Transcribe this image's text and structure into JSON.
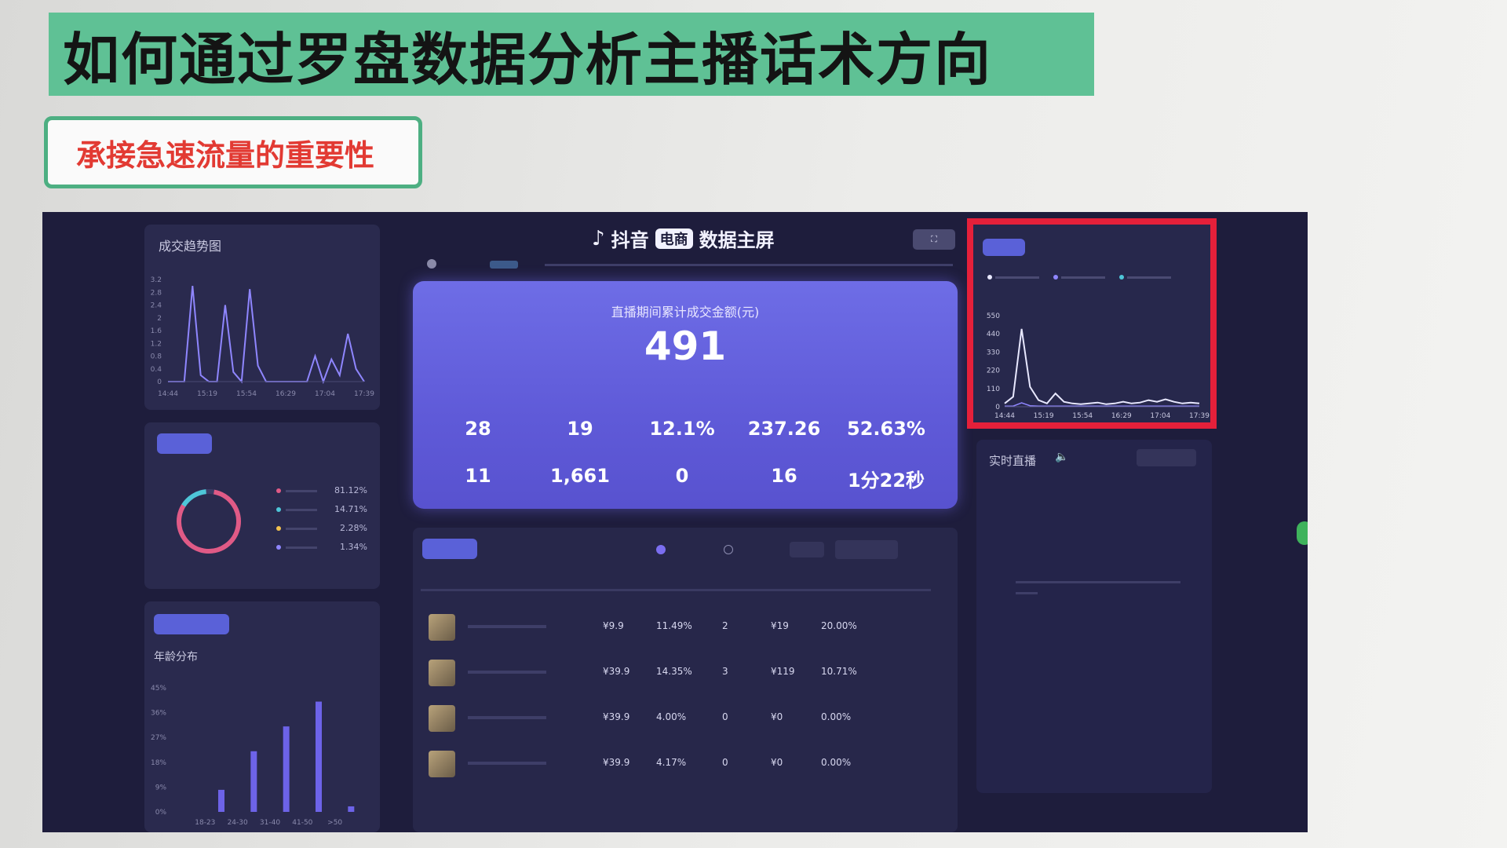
{
  "slide": {
    "title": "如何通过罗盘数据分析主播话术方向",
    "subtitle": "承接急速流量的重要性"
  },
  "left": {
    "trend_title": "成交趋势图",
    "trend_x": [
      "14:44",
      "15:19",
      "15:54",
      "16:29",
      "17:04",
      "17:39"
    ],
    "trend_y": [
      "3.2",
      "2.8",
      "2.4",
      "2",
      "1.6",
      "1.2",
      "0.8",
      "0.4",
      "0"
    ],
    "trend_values": [
      0,
      0,
      0,
      3.0,
      0.2,
      0,
      0,
      2.4,
      0.3,
      0,
      2.9,
      0.5,
      0,
      0,
      0,
      0,
      0,
      0,
      0.8,
      0,
      0.7,
      0.2,
      1.5,
      0.4,
      0
    ],
    "source_values": [
      "81.12%",
      "14.71%",
      "2.28%",
      "1.34%"
    ],
    "age_title": "年龄分布",
    "age_y": [
      "45%",
      "36%",
      "27%",
      "18%",
      "9%",
      "0%"
    ],
    "age_x": [
      "18-23",
      "24-30",
      "31-40",
      "41-50",
      ">50"
    ],
    "age_values": [
      0,
      8,
      22,
      31,
      40,
      2
    ]
  },
  "center": {
    "brand": "抖音",
    "brand_tag": "电商",
    "screen_title": "数据主屏",
    "hero_label": "直播期间累计成交金额(元)",
    "hero_value": "491",
    "metrics_row1": [
      "28",
      "19",
      "12.1%",
      "237.26",
      "52.63%"
    ],
    "metrics_row2": [
      "11",
      "1,661",
      "0",
      "16",
      "1分22秒"
    ],
    "rows": [
      {
        "price": "¥9.9",
        "rate": "11.49%",
        "orders": "2",
        "amount": "¥19",
        "conv": "20.00%"
      },
      {
        "price": "¥39.9",
        "rate": "14.35%",
        "orders": "3",
        "amount": "¥119",
        "conv": "10.71%"
      },
      {
        "price": "¥39.9",
        "rate": "4.00%",
        "orders": "0",
        "amount": "¥0",
        "conv": "0.00%"
      },
      {
        "price": "¥39.9",
        "rate": "4.17%",
        "orders": "0",
        "amount": "¥0",
        "conv": "0.00%"
      }
    ]
  },
  "right": {
    "popularity_y": [
      "550",
      "440",
      "330",
      "220",
      "110",
      "0"
    ],
    "popularity_x": [
      "14:44",
      "15:19",
      "15:54",
      "16:29",
      "17:04",
      "17:39"
    ],
    "popularity_values": [
      20,
      60,
      470,
      120,
      40,
      20,
      80,
      30,
      20,
      15,
      20,
      25,
      15,
      20,
      30,
      20,
      25,
      40,
      30,
      45,
      30,
      20,
      25,
      20
    ],
    "live_title": "实时直播"
  },
  "colors": {
    "title_bg": "#5fc195",
    "subtitle_red": "#e23a33",
    "highlight_red": "#e5203a",
    "dashboard_bg": "#1e1d3c",
    "accent": "#5a61d8"
  }
}
